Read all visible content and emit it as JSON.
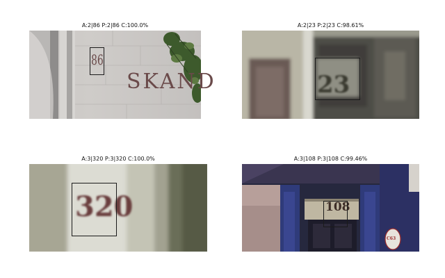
{
  "panels": [
    {
      "title": "A:2|86 P:2|86 C:100.0%",
      "house_number": "86",
      "sign_text": "SKAND"
    },
    {
      "title": "A:2|23 P:2|23 C:98.61%",
      "house_number": "23"
    },
    {
      "title": "A:3|320 P:3|320 C:100.0%",
      "house_number": "320"
    },
    {
      "title": "A:3|108 P:3|108 C:99.46%",
      "house_number": "108",
      "plate_text": "C63"
    }
  ]
}
